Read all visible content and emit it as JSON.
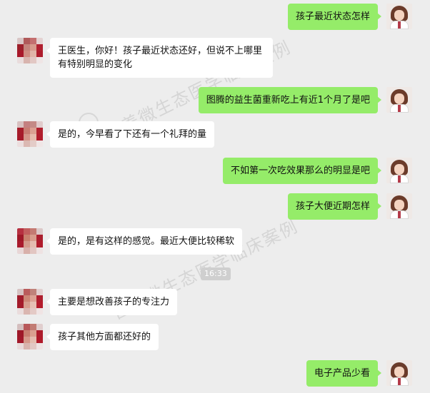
{
  "watermark": {
    "text": "营养微生态医学临床案例"
  },
  "timestamp": "16:33",
  "colors": {
    "background": "#ededed",
    "self_bubble": "#95ec69",
    "other_bubble": "#ffffff"
  },
  "messages": [
    {
      "side": "right",
      "text": "孩子最近状态怎样"
    },
    {
      "side": "left",
      "text": "王医生，你好！孩子最近状态还好，但说不上哪里有特别明显的变化"
    },
    {
      "side": "right",
      "text": "图腾的益生菌重新吃上有近1个月了是吧"
    },
    {
      "side": "left",
      "text": "是的，今早看了下还有一个礼拜的量"
    },
    {
      "side": "right",
      "text": "不如第一次吃效果那么的明显是吧"
    },
    {
      "side": "right",
      "text": "孩子大便近期怎样"
    },
    {
      "side": "left",
      "text": "是的，是有这样的感觉。最近大便比较稀软"
    },
    {
      "side": "left",
      "text": "主要是想改善孩子的专注力"
    },
    {
      "side": "left",
      "text": "孩子其他方面都还好的"
    },
    {
      "side": "right",
      "text": "电子产品少看"
    }
  ]
}
